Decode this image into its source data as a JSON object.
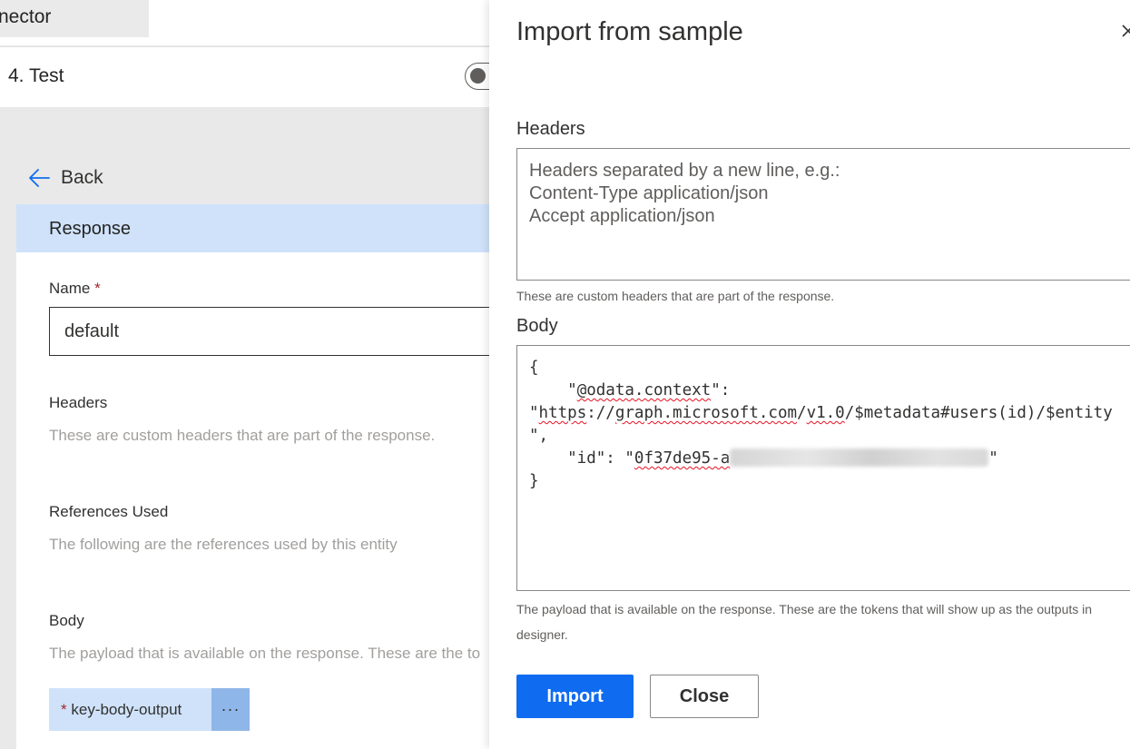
{
  "left_page": {
    "tab_title": "nector",
    "step_label": "4. Test",
    "back_label": "Back",
    "section_title": "Response",
    "name_label": "Name",
    "required_mark": "*",
    "name_value": "default",
    "headers_label": "Headers",
    "headers_hint": "These are custom headers that are part of the response.",
    "references_label": "References Used",
    "references_hint": "The following are the references used by this entity",
    "body_label": "Body",
    "body_hint": "The payload that is available on the response. These are the to",
    "body_chip_label": "key-body-output",
    "body_chip_menu": "···"
  },
  "panel": {
    "title": "Import from sample",
    "headers_label": "Headers",
    "headers_placeholder": "Headers separated by a new line, e.g.:\nContent-Type application/json\nAccept application/json",
    "headers_hint": "These are custom headers that are part of the response.",
    "body_label": "Body",
    "body_code": {
      "line1": "{",
      "line2_indent": "    \"",
      "line2_key": "@odata.context",
      "line2_end": "\":",
      "line3_q": "\"",
      "line3_p1": "https",
      "line3_p2": "://",
      "line3_p3": "graph.microsoft.com",
      "line3_p4": "/",
      "line3_p5": "v1.0",
      "line3_p6": "/$metadata#users(id)/$entity",
      "line4": "\",",
      "line5_start": "    \"id\": \"",
      "line5_id": "0f37de95-a",
      "line5_end": "\"",
      "line6": "}"
    },
    "body_hint": "The payload that is available on the response. These are the tokens that will show up as the outputs in designer.",
    "import_button": "Import",
    "close_button": "Close"
  },
  "colors": {
    "accent": "#0f6cf0",
    "section_highlight": "#cfe2fa",
    "chip_menu": "#8fb6e8",
    "required": "#a4262c"
  }
}
